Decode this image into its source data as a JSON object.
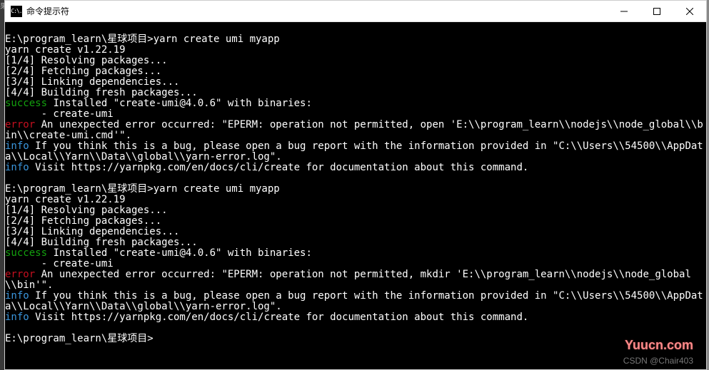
{
  "window": {
    "title": "命令提示符",
    "icon_text": "C:\\."
  },
  "watermarks": {
    "yuucn": "Yuucn.com",
    "csdn": "CSDN @Chair403"
  },
  "terminal": {
    "lines": [
      [
        {
          "cls": "c-white",
          "t": ""
        }
      ],
      [
        {
          "cls": "c-white",
          "t": "E:\\program_learn\\星球项目>yarn create umi myapp"
        }
      ],
      [
        {
          "cls": "c-white",
          "t": "yarn create v1.22.19"
        }
      ],
      [
        {
          "cls": "c-white",
          "t": "[1/4] Resolving packages..."
        }
      ],
      [
        {
          "cls": "c-white",
          "t": "[2/4] Fetching packages..."
        }
      ],
      [
        {
          "cls": "c-white",
          "t": "[3/4] Linking dependencies..."
        }
      ],
      [
        {
          "cls": "c-white",
          "t": "[4/4] Building fresh packages..."
        }
      ],
      [
        {
          "cls": "c-green",
          "t": "success"
        },
        {
          "cls": "c-white",
          "t": " Installed \"create-umi@4.0.6\" with binaries:"
        }
      ],
      [
        {
          "cls": "c-white",
          "t": "      - create-umi"
        }
      ],
      [
        {
          "cls": "c-red",
          "t": "error"
        },
        {
          "cls": "c-white",
          "t": " An unexpected error occurred: \"EPERM: operation not permitted, open 'E:\\\\program_learn\\\\nodejs\\\\node_global\\\\bin\\\\create-umi.cmd'\"."
        }
      ],
      [
        {
          "cls": "c-cyan",
          "t": "info"
        },
        {
          "cls": "c-white",
          "t": " If you think this is a bug, please open a bug report with the information provided in \"C:\\\\Users\\\\54500\\\\AppData\\\\Local\\\\Yarn\\\\Data\\\\global\\\\yarn-error.log\"."
        }
      ],
      [
        {
          "cls": "c-cyan",
          "t": "info"
        },
        {
          "cls": "c-white",
          "t": " Visit https://yarnpkg.com/en/docs/cli/create for documentation about this command."
        }
      ],
      [
        {
          "cls": "c-white",
          "t": ""
        }
      ],
      [
        {
          "cls": "c-white",
          "t": "E:\\program_learn\\星球项目>yarn create umi myapp"
        }
      ],
      [
        {
          "cls": "c-white",
          "t": "yarn create v1.22.19"
        }
      ],
      [
        {
          "cls": "c-white",
          "t": "[1/4] Resolving packages..."
        }
      ],
      [
        {
          "cls": "c-white",
          "t": "[2/4] Fetching packages..."
        }
      ],
      [
        {
          "cls": "c-white",
          "t": "[3/4] Linking dependencies..."
        }
      ],
      [
        {
          "cls": "c-white",
          "t": "[4/4] Building fresh packages..."
        }
      ],
      [
        {
          "cls": "c-green",
          "t": "success"
        },
        {
          "cls": "c-white",
          "t": " Installed \"create-umi@4.0.6\" with binaries:"
        }
      ],
      [
        {
          "cls": "c-white",
          "t": "      - create-umi"
        }
      ],
      [
        {
          "cls": "c-red",
          "t": "error"
        },
        {
          "cls": "c-white",
          "t": " An unexpected error occurred: \"EPERM: operation not permitted, mkdir 'E:\\\\program_learn\\\\nodejs\\\\node_global\\\\bin'\"."
        }
      ],
      [
        {
          "cls": "c-cyan",
          "t": "info"
        },
        {
          "cls": "c-white",
          "t": " If you think this is a bug, please open a bug report with the information provided in \"C:\\\\Users\\\\54500\\\\AppData\\\\Local\\\\Yarn\\\\Data\\\\global\\\\yarn-error.log\"."
        }
      ],
      [
        {
          "cls": "c-cyan",
          "t": "info"
        },
        {
          "cls": "c-white",
          "t": " Visit https://yarnpkg.com/en/docs/cli/create for documentation about this command."
        }
      ],
      [
        {
          "cls": "c-white",
          "t": ""
        }
      ],
      [
        {
          "cls": "c-white",
          "t": "E:\\program_learn\\星球项目>"
        }
      ]
    ]
  }
}
